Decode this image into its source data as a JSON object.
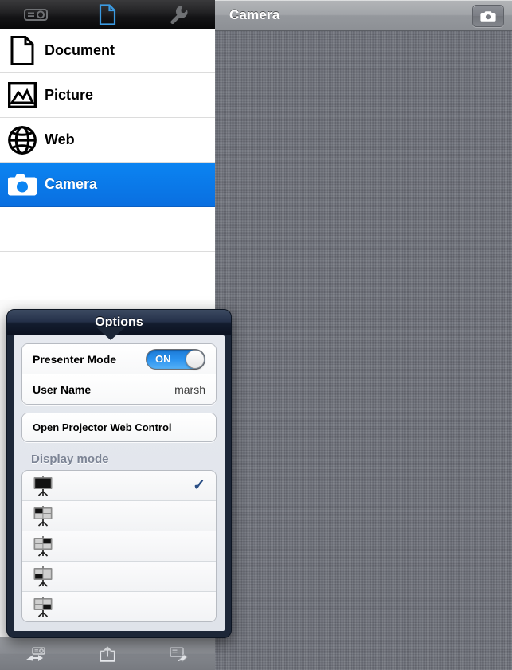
{
  "window": {
    "title": "Camera"
  },
  "top_tabbar": {
    "tabs": [
      {
        "name": "projector-tab",
        "icon": "projector-icon",
        "selected": false
      },
      {
        "name": "document-tab",
        "icon": "document-icon",
        "selected": true
      },
      {
        "name": "settings-tab",
        "icon": "wrench-icon",
        "selected": false
      }
    ]
  },
  "sidebar": {
    "items": [
      {
        "label": "Document",
        "icon": "document-page-icon",
        "selected": false
      },
      {
        "label": "Picture",
        "icon": "picture-image-icon",
        "selected": false
      },
      {
        "label": "Web",
        "icon": "globe-icon",
        "selected": false
      },
      {
        "label": "Camera",
        "icon": "camera-icon",
        "selected": true
      }
    ]
  },
  "content_header": {
    "title": "Camera",
    "camera_button_icon": "camera-icon"
  },
  "bottom_toolbar": {
    "items": [
      {
        "name": "projector-send-icon"
      },
      {
        "name": "share-export-icon"
      },
      {
        "name": "annotate-screen-icon"
      }
    ]
  },
  "popover": {
    "title": "Options",
    "presenter_mode": {
      "label": "Presenter Mode",
      "switch_state": "ON"
    },
    "user_name": {
      "label": "User Name",
      "value": "marsh"
    },
    "action": {
      "label": "Open Projector Web Control"
    },
    "display_mode": {
      "section_label": "Display mode",
      "options": [
        {
          "icon": "projector-full-screen-icon",
          "quadrant": "full",
          "selected": true,
          "check": "✓"
        },
        {
          "icon": "projector-quadrant-top-left-icon",
          "quadrant": "top-left",
          "selected": false,
          "check": "✓"
        },
        {
          "icon": "projector-quadrant-top-right-icon",
          "quadrant": "top-right",
          "selected": false,
          "check": "✓"
        },
        {
          "icon": "projector-quadrant-bottom-left-icon",
          "quadrant": "bottom-left",
          "selected": false,
          "check": "✓"
        },
        {
          "icon": "projector-quadrant-bottom-right-icon",
          "quadrant": "bottom-right",
          "selected": false,
          "check": "✓"
        }
      ]
    }
  },
  "colors": {
    "accent_blue": "#0b84f2",
    "linen_gray": "#6d7079",
    "popover_navy": "#1d2738",
    "section_label": "#7c8495"
  }
}
